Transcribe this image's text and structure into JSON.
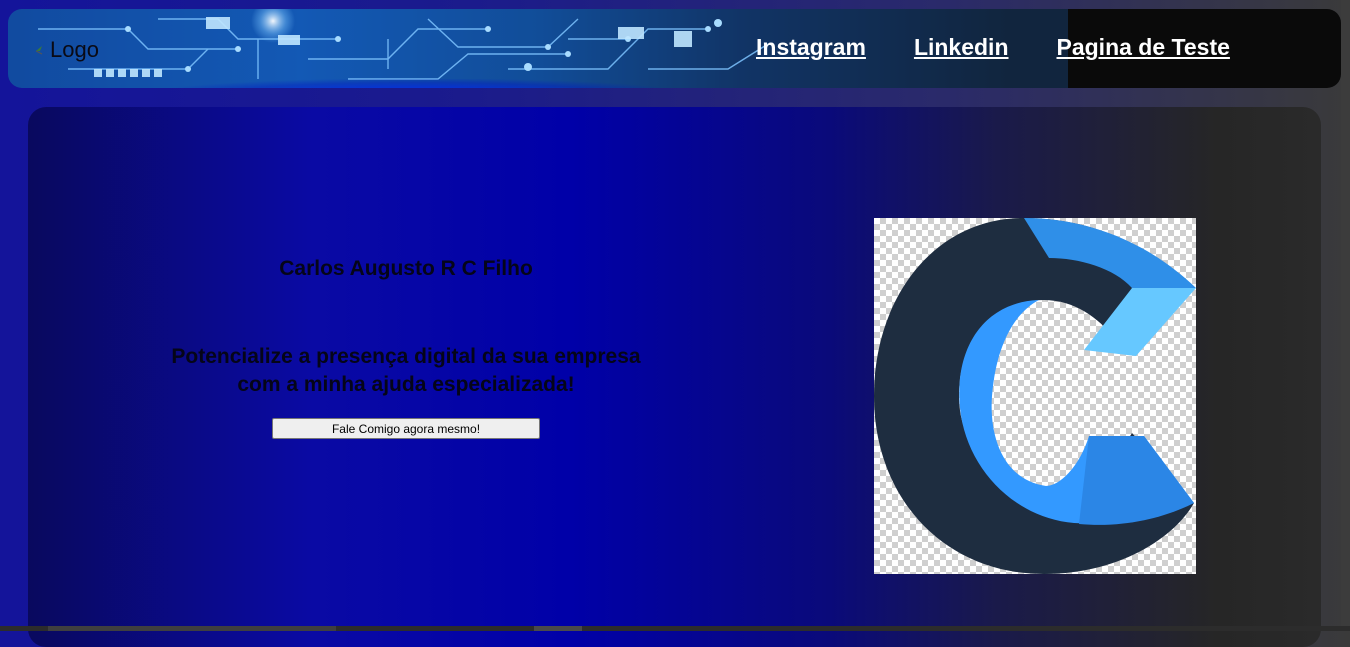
{
  "header": {
    "logo_text": "Logo",
    "nav": [
      {
        "label": "Instagram"
      },
      {
        "label": "Linkedin"
      },
      {
        "label": "Pagina de Teste"
      }
    ]
  },
  "hero": {
    "name": "Carlos Augusto R C Filho",
    "tagline_line1": "Potencialize a presença digital da sua empresa",
    "tagline_line2": "com a minha ajuda especializada!",
    "cta_label": "Fale Comigo agora mesmo!"
  },
  "colors": {
    "accent_blue": "#0000a8",
    "logo_dark": "#1e2d40",
    "logo_blue": "#3399ff",
    "logo_light": "#66c8ff"
  },
  "icons": {
    "logo_icon": "broken-image-icon",
    "hero_image": "c-letter-logo"
  }
}
